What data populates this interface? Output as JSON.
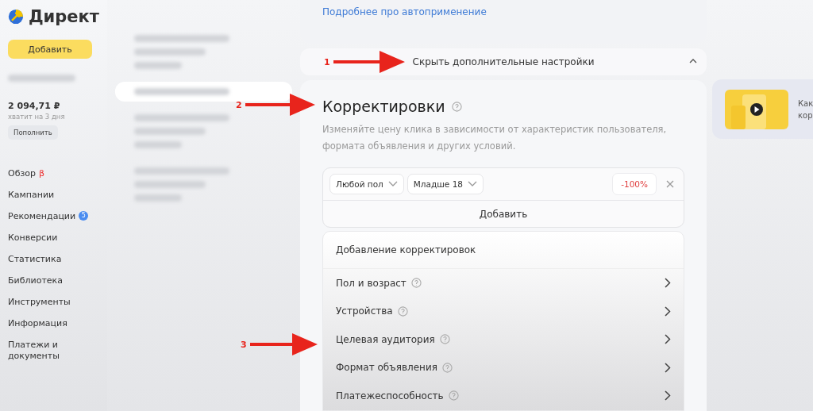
{
  "sidebar": {
    "logo": "Директ",
    "add_button": "Добавить",
    "balance": "2 094,71 ₽",
    "balance_note": "хватит на 3 дня",
    "topup_button": "Пополнить",
    "nav": [
      {
        "label": "Обзор",
        "mark": "β"
      },
      {
        "label": "Кампании"
      },
      {
        "label": "Рекомендации",
        "badge": "5"
      },
      {
        "label": "Конверсии"
      },
      {
        "label": "Статистика"
      },
      {
        "label": "Библиотека"
      },
      {
        "label": "Инструменты"
      },
      {
        "label": "Информация"
      },
      {
        "label": "Платежи и документы"
      }
    ]
  },
  "campaign_list": [
    {
      "selected": false
    },
    {
      "selected": true
    },
    {
      "selected": false
    },
    {
      "selected": false
    }
  ],
  "autoapply_link": "Подробнее про автоприменение",
  "settings_toggle": {
    "label": "Скрыть дополнительные настройки",
    "expanded": true
  },
  "corrections": {
    "title": "Корректировки",
    "description": "Изменяйте цену клика в зависимости от характеристик пользователя, формата объявления и других условий.",
    "filters": [
      "Любой пол",
      "Младше 18"
    ],
    "value": "-100%",
    "add_button": "Добавить"
  },
  "menu": {
    "title": "Добавление корректировок",
    "items": [
      "Пол и возраст",
      "Устройства",
      "Целевая аудитория",
      "Формат объявления",
      "Платежеспособность"
    ]
  },
  "video_card": {
    "lines": [
      "Как",
      "кор"
    ]
  },
  "annotations": [
    "1",
    "2",
    "3"
  ]
}
